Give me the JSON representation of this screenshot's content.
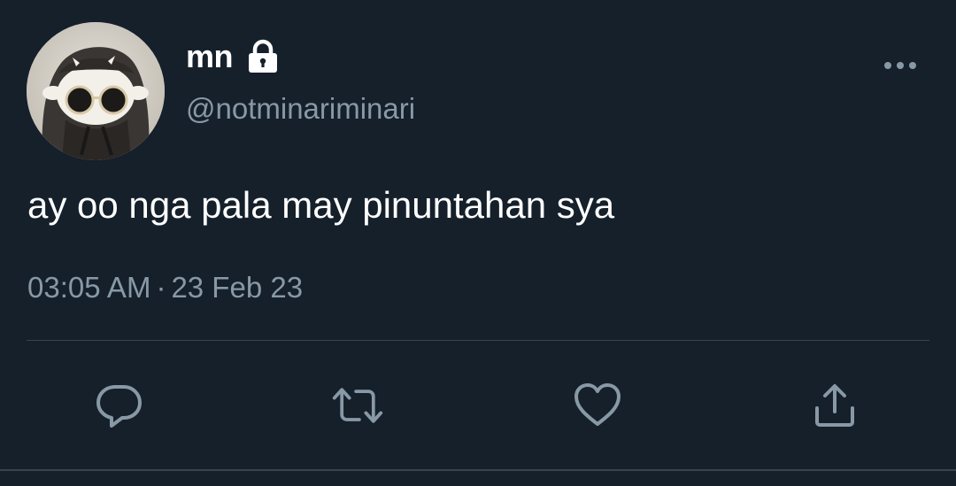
{
  "user": {
    "display_name": "mn",
    "handle": "@notminariminari",
    "protected": true
  },
  "tweet": {
    "text": "ay oo nga pala may pinuntahan sya",
    "time": "03:05 AM",
    "separator": "·",
    "date": "23 Feb 23"
  },
  "actions": [
    "reply-icon",
    "retweet-icon",
    "like-icon",
    "share-icon"
  ],
  "colors": {
    "background": "#15202b",
    "text_primary": "#ffffff",
    "text_secondary": "#8899a6",
    "divider": "#38444d"
  }
}
